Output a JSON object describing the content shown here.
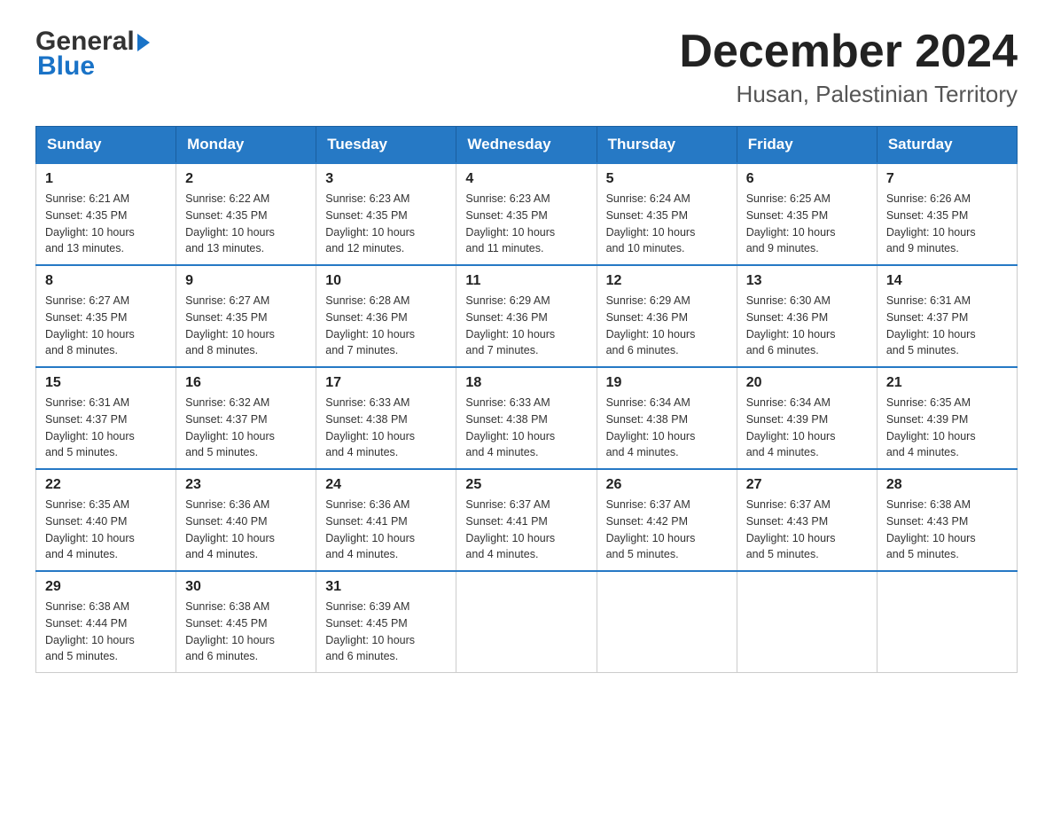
{
  "header": {
    "logo_general": "General",
    "logo_blue": "Blue",
    "title": "December 2024",
    "subtitle": "Husan, Palestinian Territory"
  },
  "days_of_week": [
    "Sunday",
    "Monday",
    "Tuesday",
    "Wednesday",
    "Thursday",
    "Friday",
    "Saturday"
  ],
  "weeks": [
    [
      {
        "day": "1",
        "sunrise": "6:21 AM",
        "sunset": "4:35 PM",
        "daylight": "10 hours and 13 minutes."
      },
      {
        "day": "2",
        "sunrise": "6:22 AM",
        "sunset": "4:35 PM",
        "daylight": "10 hours and 13 minutes."
      },
      {
        "day": "3",
        "sunrise": "6:23 AM",
        "sunset": "4:35 PM",
        "daylight": "10 hours and 12 minutes."
      },
      {
        "day": "4",
        "sunrise": "6:23 AM",
        "sunset": "4:35 PM",
        "daylight": "10 hours and 11 minutes."
      },
      {
        "day": "5",
        "sunrise": "6:24 AM",
        "sunset": "4:35 PM",
        "daylight": "10 hours and 10 minutes."
      },
      {
        "day": "6",
        "sunrise": "6:25 AM",
        "sunset": "4:35 PM",
        "daylight": "10 hours and 9 minutes."
      },
      {
        "day": "7",
        "sunrise": "6:26 AM",
        "sunset": "4:35 PM",
        "daylight": "10 hours and 9 minutes."
      }
    ],
    [
      {
        "day": "8",
        "sunrise": "6:27 AM",
        "sunset": "4:35 PM",
        "daylight": "10 hours and 8 minutes."
      },
      {
        "day": "9",
        "sunrise": "6:27 AM",
        "sunset": "4:35 PM",
        "daylight": "10 hours and 8 minutes."
      },
      {
        "day": "10",
        "sunrise": "6:28 AM",
        "sunset": "4:36 PM",
        "daylight": "10 hours and 7 minutes."
      },
      {
        "day": "11",
        "sunrise": "6:29 AM",
        "sunset": "4:36 PM",
        "daylight": "10 hours and 7 minutes."
      },
      {
        "day": "12",
        "sunrise": "6:29 AM",
        "sunset": "4:36 PM",
        "daylight": "10 hours and 6 minutes."
      },
      {
        "day": "13",
        "sunrise": "6:30 AM",
        "sunset": "4:36 PM",
        "daylight": "10 hours and 6 minutes."
      },
      {
        "day": "14",
        "sunrise": "6:31 AM",
        "sunset": "4:37 PM",
        "daylight": "10 hours and 5 minutes."
      }
    ],
    [
      {
        "day": "15",
        "sunrise": "6:31 AM",
        "sunset": "4:37 PM",
        "daylight": "10 hours and 5 minutes."
      },
      {
        "day": "16",
        "sunrise": "6:32 AM",
        "sunset": "4:37 PM",
        "daylight": "10 hours and 5 minutes."
      },
      {
        "day": "17",
        "sunrise": "6:33 AM",
        "sunset": "4:38 PM",
        "daylight": "10 hours and 4 minutes."
      },
      {
        "day": "18",
        "sunrise": "6:33 AM",
        "sunset": "4:38 PM",
        "daylight": "10 hours and 4 minutes."
      },
      {
        "day": "19",
        "sunrise": "6:34 AM",
        "sunset": "4:38 PM",
        "daylight": "10 hours and 4 minutes."
      },
      {
        "day": "20",
        "sunrise": "6:34 AM",
        "sunset": "4:39 PM",
        "daylight": "10 hours and 4 minutes."
      },
      {
        "day": "21",
        "sunrise": "6:35 AM",
        "sunset": "4:39 PM",
        "daylight": "10 hours and 4 minutes."
      }
    ],
    [
      {
        "day": "22",
        "sunrise": "6:35 AM",
        "sunset": "4:40 PM",
        "daylight": "10 hours and 4 minutes."
      },
      {
        "day": "23",
        "sunrise": "6:36 AM",
        "sunset": "4:40 PM",
        "daylight": "10 hours and 4 minutes."
      },
      {
        "day": "24",
        "sunrise": "6:36 AM",
        "sunset": "4:41 PM",
        "daylight": "10 hours and 4 minutes."
      },
      {
        "day": "25",
        "sunrise": "6:37 AM",
        "sunset": "4:41 PM",
        "daylight": "10 hours and 4 minutes."
      },
      {
        "day": "26",
        "sunrise": "6:37 AM",
        "sunset": "4:42 PM",
        "daylight": "10 hours and 5 minutes."
      },
      {
        "day": "27",
        "sunrise": "6:37 AM",
        "sunset": "4:43 PM",
        "daylight": "10 hours and 5 minutes."
      },
      {
        "day": "28",
        "sunrise": "6:38 AM",
        "sunset": "4:43 PM",
        "daylight": "10 hours and 5 minutes."
      }
    ],
    [
      {
        "day": "29",
        "sunrise": "6:38 AM",
        "sunset": "4:44 PM",
        "daylight": "10 hours and 5 minutes."
      },
      {
        "day": "30",
        "sunrise": "6:38 AM",
        "sunset": "4:45 PM",
        "daylight": "10 hours and 6 minutes."
      },
      {
        "day": "31",
        "sunrise": "6:39 AM",
        "sunset": "4:45 PM",
        "daylight": "10 hours and 6 minutes."
      },
      null,
      null,
      null,
      null
    ]
  ],
  "labels": {
    "sunrise": "Sunrise:",
    "sunset": "Sunset:",
    "daylight": "Daylight:"
  }
}
